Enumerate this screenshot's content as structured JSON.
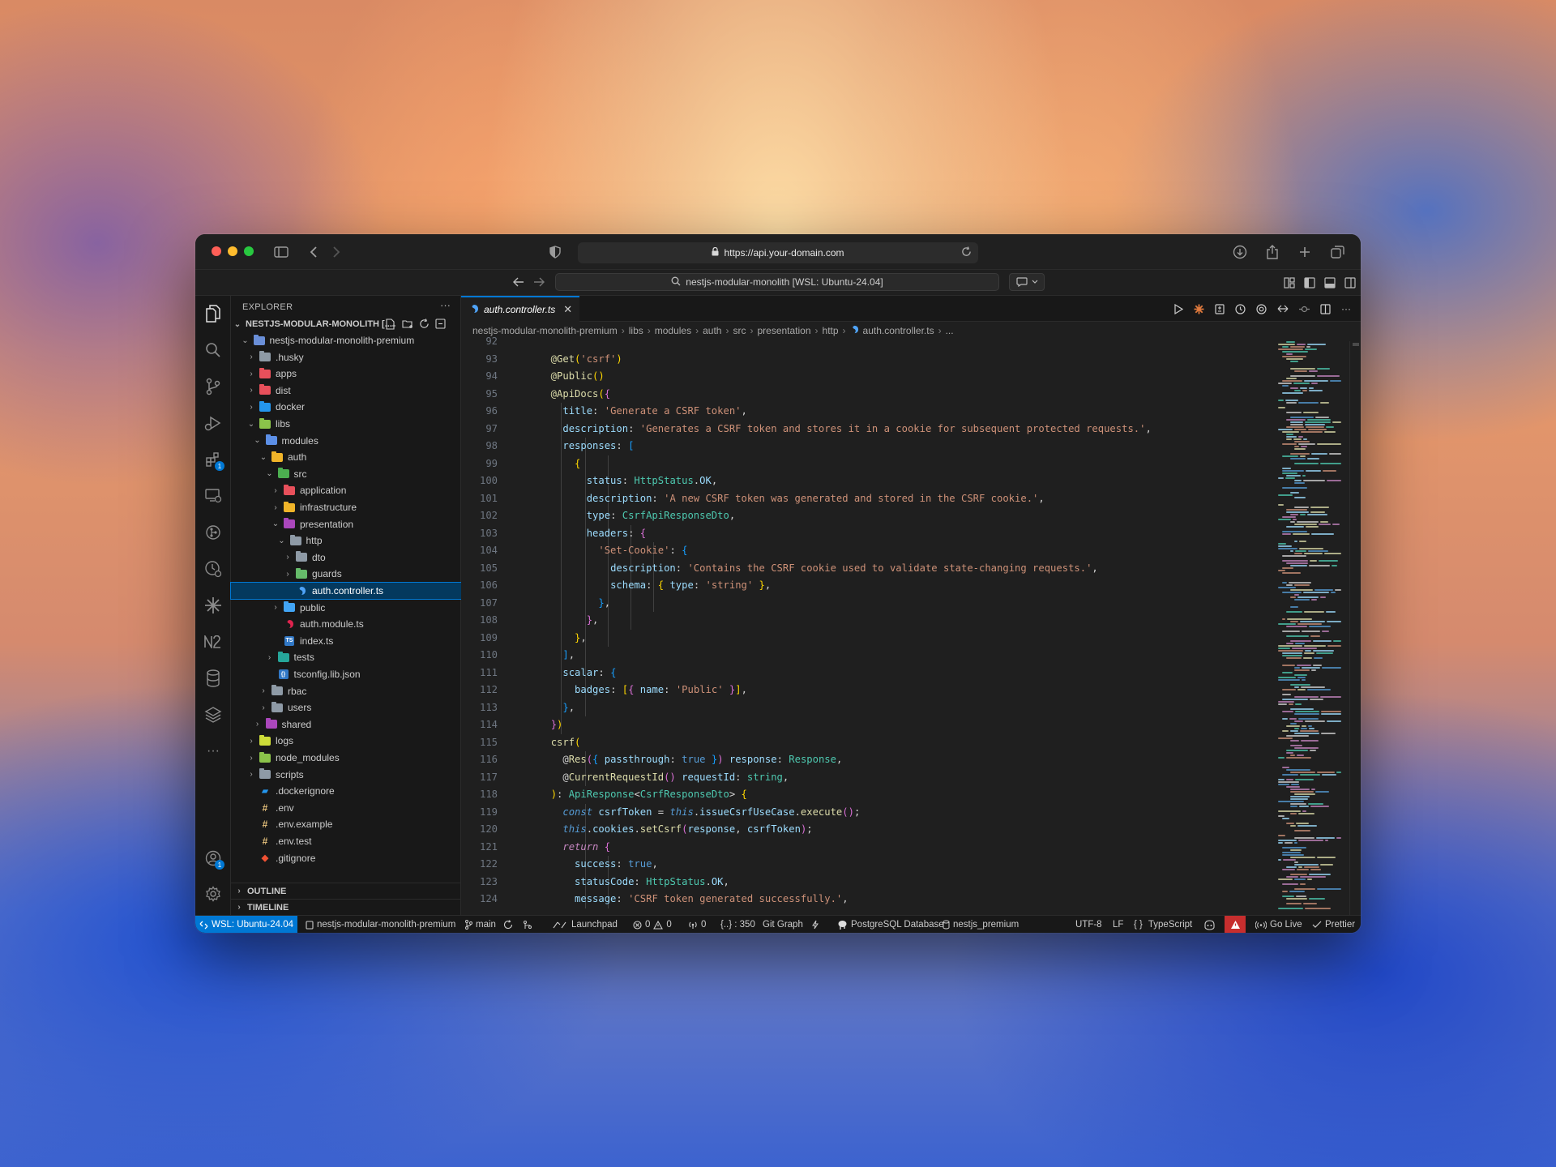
{
  "browser": {
    "url": "https://api.your-domain.com",
    "search_text": "nestjs-modular-monolith [WSL: Ubuntu-24.04]"
  },
  "sidebar": {
    "title": "EXPLORER",
    "root_label": "NESTJS-MODULAR-MONOLITH [...",
    "items": [
      {
        "label": "nestjs-modular-monolith-premium",
        "depth": 1,
        "type": "folder",
        "open": true,
        "color": "#6a8fd8"
      },
      {
        "label": ".husky",
        "depth": 2,
        "type": "folder",
        "open": false,
        "color": "#8e9aa6"
      },
      {
        "label": "apps",
        "depth": 2,
        "type": "folder",
        "open": false,
        "color": "#e8505b"
      },
      {
        "label": "dist",
        "depth": 2,
        "type": "folder",
        "open": false,
        "color": "#e8505b"
      },
      {
        "label": "docker",
        "depth": 2,
        "type": "folder",
        "open": false,
        "color": "#2496ed"
      },
      {
        "label": "libs",
        "depth": 2,
        "type": "folder",
        "open": true,
        "color": "#8bc34a"
      },
      {
        "label": "modules",
        "depth": 3,
        "type": "folder",
        "open": true,
        "color": "#5c8fe6"
      },
      {
        "label": "auth",
        "depth": 4,
        "type": "folder",
        "open": true,
        "color": "#f0b429"
      },
      {
        "label": "src",
        "depth": 5,
        "type": "folder",
        "open": true,
        "color": "#4caf50"
      },
      {
        "label": "application",
        "depth": 6,
        "type": "folder",
        "open": false,
        "color": "#e8505b"
      },
      {
        "label": "infrastructure",
        "depth": 6,
        "type": "folder",
        "open": false,
        "color": "#f0b429"
      },
      {
        "label": "presentation",
        "depth": 6,
        "type": "folder",
        "open": true,
        "color": "#ab47bc"
      },
      {
        "label": "http",
        "depth": 7,
        "type": "folder",
        "open": true,
        "color": "#8e9aa6"
      },
      {
        "label": "dto",
        "depth": 8,
        "type": "folder",
        "open": false,
        "color": "#8e9aa6"
      },
      {
        "label": "guards",
        "depth": 8,
        "type": "folder",
        "open": false,
        "color": "#66bb6a"
      },
      {
        "label": "auth.controller.ts",
        "depth": 8,
        "type": "file",
        "icon": "nest",
        "color": "#4fa3f7",
        "selected": true
      },
      {
        "label": "public",
        "depth": 6,
        "type": "folder",
        "open": false,
        "color": "#42a5f5"
      },
      {
        "label": "auth.module.ts",
        "depth": 6,
        "type": "file",
        "icon": "nest",
        "color": "#e0234e"
      },
      {
        "label": "index.ts",
        "depth": 6,
        "type": "file",
        "icon": "ts",
        "color": "#3178c6"
      },
      {
        "label": "tests",
        "depth": 5,
        "type": "folder",
        "open": false,
        "color": "#26a69a"
      },
      {
        "label": "tsconfig.lib.json",
        "depth": 5,
        "type": "file",
        "icon": "tsconfig",
        "color": "#3178c6"
      },
      {
        "label": "rbac",
        "depth": 4,
        "type": "folder",
        "open": false,
        "color": "#8e9aa6"
      },
      {
        "label": "users",
        "depth": 4,
        "type": "folder",
        "open": false,
        "color": "#8e9aa6"
      },
      {
        "label": "shared",
        "depth": 3,
        "type": "folder",
        "open": false,
        "color": "#ab47bc"
      },
      {
        "label": "logs",
        "depth": 2,
        "type": "folder",
        "open": false,
        "color": "#cddc39"
      },
      {
        "label": "node_modules",
        "depth": 2,
        "type": "folder",
        "open": false,
        "color": "#8bc34a"
      },
      {
        "label": "scripts",
        "depth": 2,
        "type": "folder",
        "open": false,
        "color": "#8e9aa6"
      },
      {
        "label": ".dockerignore",
        "depth": 2,
        "type": "file",
        "icon": "docker",
        "color": "#2496ed"
      },
      {
        "label": ".env",
        "depth": 2,
        "type": "file",
        "icon": "env",
        "color": "#e5c07b"
      },
      {
        "label": ".env.example",
        "depth": 2,
        "type": "file",
        "icon": "env",
        "color": "#e5c07b"
      },
      {
        "label": ".env.test",
        "depth": 2,
        "type": "file",
        "icon": "env",
        "color": "#e5c07b"
      },
      {
        "label": ".gitignore",
        "depth": 2,
        "type": "file",
        "icon": "git",
        "color": "#f05133"
      }
    ],
    "outline_label": "OUTLINE",
    "timeline_label": "TIMELINE"
  },
  "editor": {
    "active_tab": "auth.controller.ts",
    "breadcrumb": [
      "nestjs-modular-monolith-premium",
      "libs",
      "modules",
      "auth",
      "src",
      "presentation",
      "http",
      "auth.controller.ts",
      "..."
    ],
    "lines": [
      {
        "n": "92",
        "t": []
      },
      {
        "n": "93",
        "t": [
          [
            "  @",
            "d"
          ],
          [
            "Get",
            "d"
          ],
          [
            "(",
            "y"
          ],
          [
            "'csrf'",
            "s"
          ],
          [
            ")",
            "y"
          ]
        ]
      },
      {
        "n": "94",
        "t": [
          [
            "  @",
            "d"
          ],
          [
            "Public",
            "d"
          ],
          [
            "(",
            "y"
          ],
          [
            ")",
            "y"
          ]
        ]
      },
      {
        "n": "95",
        "t": [
          [
            "  @",
            "d"
          ],
          [
            "ApiDocs",
            "d"
          ],
          [
            "(",
            "y"
          ],
          [
            "{",
            "pu"
          ]
        ]
      },
      {
        "n": "96",
        "t": [
          [
            "    ",
            ""
          ],
          [
            "title",
            "v"
          ],
          [
            ": ",
            ""
          ],
          [
            "'Generate a CSRF token'",
            "s"
          ],
          [
            ",",
            ""
          ]
        ]
      },
      {
        "n": "97",
        "t": [
          [
            "    ",
            ""
          ],
          [
            "description",
            "v"
          ],
          [
            ": ",
            ""
          ],
          [
            "'Generates a CSRF token and stores it in a cookie for subsequent protected requests.'",
            "s"
          ],
          [
            ",",
            ""
          ]
        ]
      },
      {
        "n": "98",
        "t": [
          [
            "    ",
            ""
          ],
          [
            "responses",
            "v"
          ],
          [
            ": ",
            ""
          ],
          [
            "[",
            "bl"
          ]
        ]
      },
      {
        "n": "99",
        "t": [
          [
            "      ",
            ""
          ],
          [
            "{",
            "y"
          ]
        ]
      },
      {
        "n": "100",
        "t": [
          [
            "        ",
            ""
          ],
          [
            "status",
            "v"
          ],
          [
            ": ",
            ""
          ],
          [
            "HttpStatus",
            "t"
          ],
          [
            ".",
            ""
          ],
          [
            "OK",
            "v"
          ],
          [
            ",",
            ""
          ]
        ]
      },
      {
        "n": "101",
        "t": [
          [
            "        ",
            ""
          ],
          [
            "description",
            "v"
          ],
          [
            ": ",
            ""
          ],
          [
            "'A new CSRF token was generated and stored in the CSRF cookie.'",
            "s"
          ],
          [
            ",",
            ""
          ]
        ]
      },
      {
        "n": "102",
        "t": [
          [
            "        ",
            ""
          ],
          [
            "type",
            "v"
          ],
          [
            ": ",
            ""
          ],
          [
            "CsrfApiResponseDto",
            "t"
          ],
          [
            ",",
            ""
          ]
        ]
      },
      {
        "n": "103",
        "t": [
          [
            "        ",
            ""
          ],
          [
            "headers",
            "v"
          ],
          [
            ": ",
            ""
          ],
          [
            "{",
            "pu"
          ]
        ]
      },
      {
        "n": "104",
        "t": [
          [
            "          ",
            ""
          ],
          [
            "'Set-Cookie'",
            "s"
          ],
          [
            ": ",
            ""
          ],
          [
            "{",
            "bl"
          ]
        ]
      },
      {
        "n": "105",
        "t": [
          [
            "            ",
            ""
          ],
          [
            "description",
            "v"
          ],
          [
            ": ",
            ""
          ],
          [
            "'Contains the CSRF cookie used to validate state-changing requests.'",
            "s"
          ],
          [
            ",",
            ""
          ]
        ]
      },
      {
        "n": "106",
        "t": [
          [
            "            ",
            ""
          ],
          [
            "schema",
            "v"
          ],
          [
            ": ",
            ""
          ],
          [
            "{ ",
            "y"
          ],
          [
            "type",
            "v"
          ],
          [
            ": ",
            ""
          ],
          [
            "'string'",
            "s"
          ],
          [
            " }",
            "y"
          ],
          [
            ",",
            ""
          ]
        ]
      },
      {
        "n": "107",
        "t": [
          [
            "          ",
            ""
          ],
          [
            "}",
            "bl"
          ],
          [
            ",",
            ""
          ]
        ]
      },
      {
        "n": "108",
        "t": [
          [
            "        ",
            ""
          ],
          [
            "}",
            "pu"
          ],
          [
            ",",
            ""
          ]
        ]
      },
      {
        "n": "109",
        "t": [
          [
            "      ",
            ""
          ],
          [
            "}",
            "y"
          ],
          [
            ",",
            ""
          ]
        ]
      },
      {
        "n": "110",
        "t": [
          [
            "    ",
            ""
          ],
          [
            "]",
            "bl"
          ],
          [
            ",",
            ""
          ]
        ]
      },
      {
        "n": "111",
        "t": [
          [
            "    ",
            ""
          ],
          [
            "scalar",
            "v"
          ],
          [
            ": ",
            ""
          ],
          [
            "{",
            "bl"
          ]
        ]
      },
      {
        "n": "112",
        "t": [
          [
            "      ",
            ""
          ],
          [
            "badges",
            "v"
          ],
          [
            ": ",
            ""
          ],
          [
            "[",
            "y"
          ],
          [
            "{ ",
            "pu"
          ],
          [
            "name",
            "v"
          ],
          [
            ": ",
            ""
          ],
          [
            "'Public'",
            "s"
          ],
          [
            " }",
            "pu"
          ],
          [
            "]",
            "y"
          ],
          [
            ",",
            ""
          ]
        ]
      },
      {
        "n": "113",
        "t": [
          [
            "    ",
            ""
          ],
          [
            "}",
            "bl"
          ],
          [
            ",",
            ""
          ]
        ]
      },
      {
        "n": "114",
        "t": [
          [
            "  ",
            ""
          ],
          [
            "}",
            "pu"
          ],
          [
            ")",
            "y"
          ]
        ]
      },
      {
        "n": "115",
        "t": [
          [
            "  ",
            ""
          ],
          [
            "csrf",
            "d"
          ],
          [
            "(",
            "y"
          ]
        ]
      },
      {
        "n": "116",
        "t": [
          [
            "    @",
            ""
          ],
          [
            "Res",
            "d"
          ],
          [
            "(",
            "pu"
          ],
          [
            "{ ",
            "bl"
          ],
          [
            "passthrough",
            "v"
          ],
          [
            ": ",
            ""
          ],
          [
            "true",
            "b"
          ],
          [
            " }",
            "bl"
          ],
          [
            ")",
            "pu"
          ],
          [
            " ",
            ""
          ],
          [
            "response",
            "v"
          ],
          [
            ": ",
            ""
          ],
          [
            "Response",
            "t"
          ],
          [
            ",",
            ""
          ]
        ]
      },
      {
        "n": "117",
        "t": [
          [
            "    @",
            ""
          ],
          [
            "CurrentRequestId",
            "d"
          ],
          [
            "()",
            "pu"
          ],
          [
            " ",
            ""
          ],
          [
            "requestId",
            "v"
          ],
          [
            ": ",
            ""
          ],
          [
            "string",
            "t"
          ],
          [
            ",",
            ""
          ]
        ]
      },
      {
        "n": "118",
        "t": [
          [
            "  ",
            ""
          ],
          [
            ")",
            "y"
          ],
          [
            ": ",
            ""
          ],
          [
            "ApiResponse",
            "t"
          ],
          [
            "<",
            ""
          ],
          [
            "CsrfResponseDto",
            "t"
          ],
          [
            "> ",
            ""
          ],
          [
            "{",
            "y"
          ]
        ]
      },
      {
        "n": "119",
        "t": [
          [
            "    ",
            ""
          ],
          [
            "const",
            "b i"
          ],
          [
            " ",
            ""
          ],
          [
            "csrfToken",
            "v"
          ],
          [
            " = ",
            ""
          ],
          [
            "this",
            "b i"
          ],
          [
            ".",
            ""
          ],
          [
            "issueCsrfUseCase",
            "v"
          ],
          [
            ".",
            ""
          ],
          [
            "execute",
            "d"
          ],
          [
            "()",
            "pu"
          ],
          [
            ";",
            ""
          ]
        ]
      },
      {
        "n": "120",
        "t": [
          [
            "    ",
            ""
          ],
          [
            "this",
            "b i"
          ],
          [
            ".",
            ""
          ],
          [
            "cookies",
            "v"
          ],
          [
            ".",
            ""
          ],
          [
            "setCsrf",
            "d"
          ],
          [
            "(",
            "pu"
          ],
          [
            "response",
            "v"
          ],
          [
            ", ",
            ""
          ],
          [
            "csrfToken",
            "v"
          ],
          [
            ")",
            "pu"
          ],
          [
            ";",
            ""
          ]
        ]
      },
      {
        "n": "121",
        "t": [
          [
            "    ",
            ""
          ],
          [
            "return",
            "k i"
          ],
          [
            " ",
            ""
          ],
          [
            "{",
            "pu"
          ]
        ]
      },
      {
        "n": "122",
        "t": [
          [
            "      ",
            ""
          ],
          [
            "success",
            "v"
          ],
          [
            ": ",
            ""
          ],
          [
            "true",
            "b"
          ],
          [
            ",",
            ""
          ]
        ]
      },
      {
        "n": "123",
        "t": [
          [
            "      ",
            ""
          ],
          [
            "statusCode",
            "v"
          ],
          [
            ": ",
            ""
          ],
          [
            "HttpStatus",
            "t"
          ],
          [
            ".",
            ""
          ],
          [
            "OK",
            "v"
          ],
          [
            ",",
            ""
          ]
        ]
      },
      {
        "n": "124",
        "t": [
          [
            "      ",
            ""
          ],
          [
            "message",
            "v"
          ],
          [
            ": ",
            ""
          ],
          [
            "'CSRF token generated successfully.'",
            "s"
          ],
          [
            ",",
            ""
          ]
        ]
      }
    ]
  },
  "statusbar": {
    "remote": "WSL: Ubuntu-24.04",
    "workspace": "nestjs-modular-monolith-premium",
    "branch": "main",
    "launchpad": "Launchpad",
    "errors": "0",
    "warnings": "0",
    "ports": "0",
    "position": "{..} : 350",
    "git_graph": "Git Graph",
    "database": "PostgreSQL Database",
    "db_name": "nestjs_premium",
    "encoding": "UTF-8",
    "eol": "LF",
    "language": "TypeScript",
    "go_live": "Go Live",
    "prettier": "Prettier"
  },
  "colors": {
    "accent": "#0078d4",
    "status_remote": "#0078d4",
    "error_badge": "#c72e2e"
  }
}
